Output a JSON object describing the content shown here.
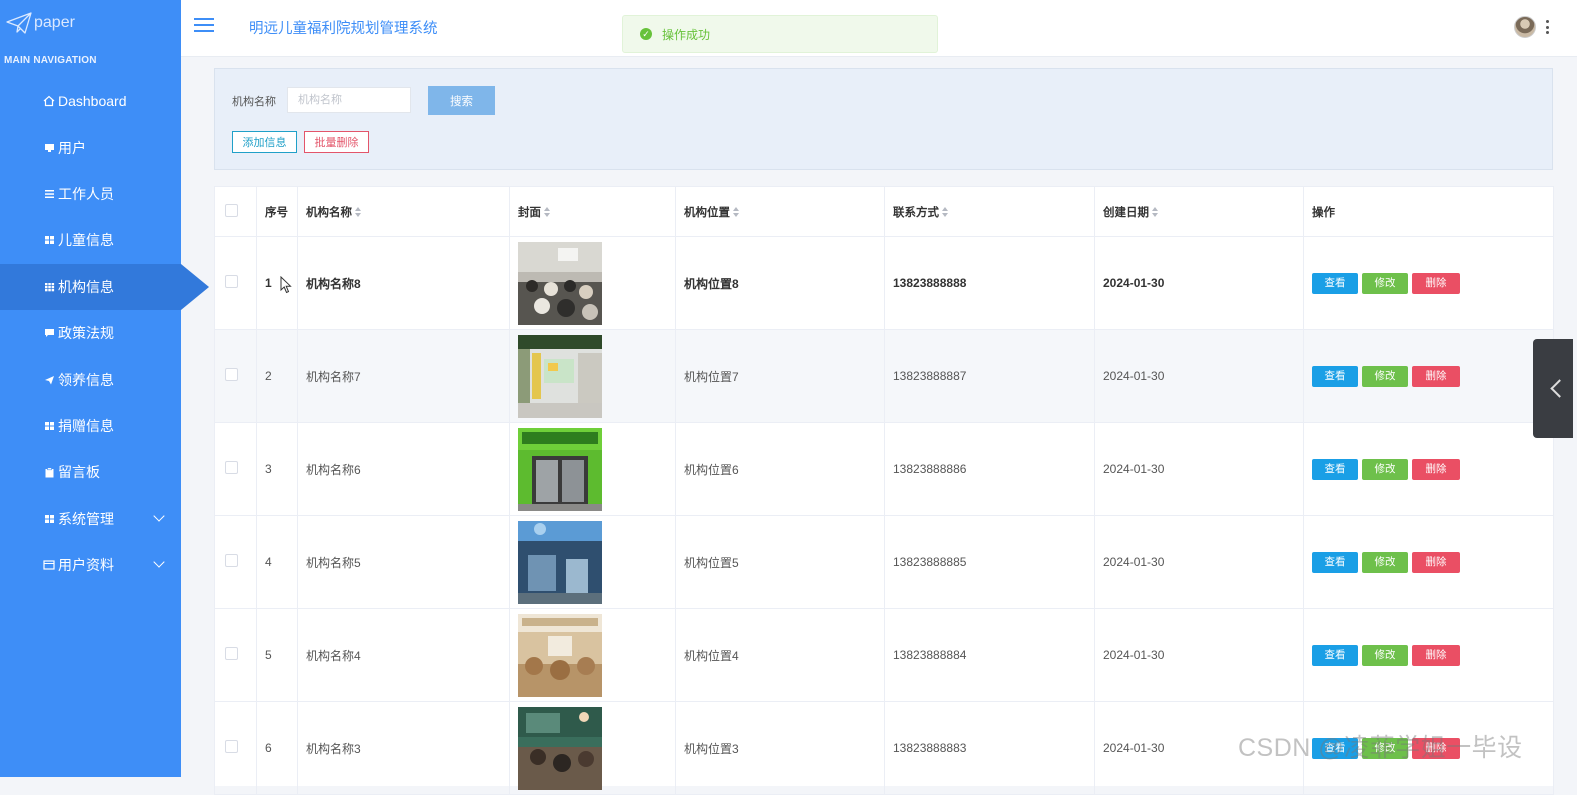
{
  "app": {
    "logo_text": "paper",
    "nav_caption": "MAIN NAVIGATION",
    "title": "明远儿童福利院规划管理系统"
  },
  "sidebar": {
    "items": [
      {
        "label": "Dashboard",
        "icon": "home-icon"
      },
      {
        "label": "用户",
        "icon": "monitor-icon"
      },
      {
        "label": "工作人员",
        "icon": "list-icon"
      },
      {
        "label": "儿童信息",
        "icon": "grid-icon"
      },
      {
        "label": "机构信息",
        "icon": "grid-icon",
        "active": true
      },
      {
        "label": "政策法规",
        "icon": "comment-icon"
      },
      {
        "label": "领养信息",
        "icon": "send-icon"
      },
      {
        "label": "捐赠信息",
        "icon": "grid-icon"
      },
      {
        "label": "留言板",
        "icon": "clipboard-icon"
      },
      {
        "label": "系统管理",
        "icon": "grid-icon",
        "expandable": true
      },
      {
        "label": "用户资料",
        "icon": "card-icon",
        "expandable": true
      }
    ]
  },
  "toast": {
    "message": "操作成功",
    "color": "#67c23a"
  },
  "search": {
    "label": "机构名称",
    "placeholder": "机构名称",
    "value": "",
    "button_label": "搜索"
  },
  "toolbar": {
    "add_label": "添加信息",
    "batch_delete_label": "批量删除"
  },
  "table": {
    "columns": [
      "序号",
      "机构名称",
      "封面",
      "机构位置",
      "联系方式",
      "创建日期",
      "操作"
    ],
    "rows": [
      {
        "index": "1",
        "name": "机构名称8",
        "location": "机构位置8",
        "contact": "13823888888",
        "date": "2024-01-30"
      },
      {
        "index": "2",
        "name": "机构名称7",
        "location": "机构位置7",
        "contact": "13823888887",
        "date": "2024-01-30"
      },
      {
        "index": "3",
        "name": "机构名称6",
        "location": "机构位置6",
        "contact": "13823888886",
        "date": "2024-01-30"
      },
      {
        "index": "4",
        "name": "机构名称5",
        "location": "机构位置5",
        "contact": "13823888885",
        "date": "2024-01-30"
      },
      {
        "index": "5",
        "name": "机构名称4",
        "location": "机构位置4",
        "contact": "13823888884",
        "date": "2024-01-30"
      },
      {
        "index": "6",
        "name": "机构名称3",
        "location": "机构位置3",
        "contact": "13823888883",
        "date": "2024-01-30"
      }
    ],
    "actions": {
      "view": "查看",
      "edit": "修改",
      "delete": "删除"
    }
  },
  "watermark": "CSDN @凌菲学姐一毕设",
  "colors": {
    "sidebar": "#3e8ef7",
    "sidebar_active": "#3279db",
    "view": "#1a9fe6",
    "edit": "#6ec04b",
    "delete": "#ea4f64"
  }
}
